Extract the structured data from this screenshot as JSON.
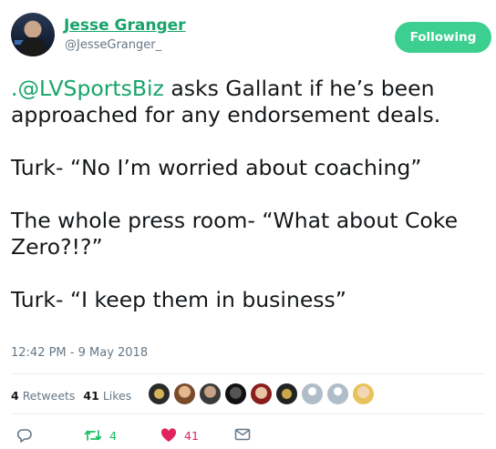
{
  "author": {
    "display_name": "Jesse Granger",
    "handle": "@JesseGranger_"
  },
  "follow_button": {
    "label": "Following",
    "color": "#3ccf8f"
  },
  "tweet": {
    "mention": ".@LVSportsBiz",
    "line1_rest": " asks Gallant if he’s been approached for any endorsement deals.",
    "line2": "Turk- “No I’m worried about coaching”",
    "line3": "The whole press room- “What about Coke Zero?!?”",
    "line4": "Turk- “I keep them in business”",
    "timestamp": "12:42 PM - 9 May 2018"
  },
  "stats": {
    "retweets_count": "4",
    "retweets_label": "Retweets",
    "likes_count": "41",
    "likes_label": "Likes"
  },
  "actions": {
    "reply_icon": "reply-icon",
    "retweet_count": "4",
    "like_count": "41",
    "dm_icon": "envelope-icon"
  },
  "colors": {
    "link": "#17a36b",
    "retweet": "#17bf63",
    "like": "#e0245e",
    "muted": "#657786"
  }
}
